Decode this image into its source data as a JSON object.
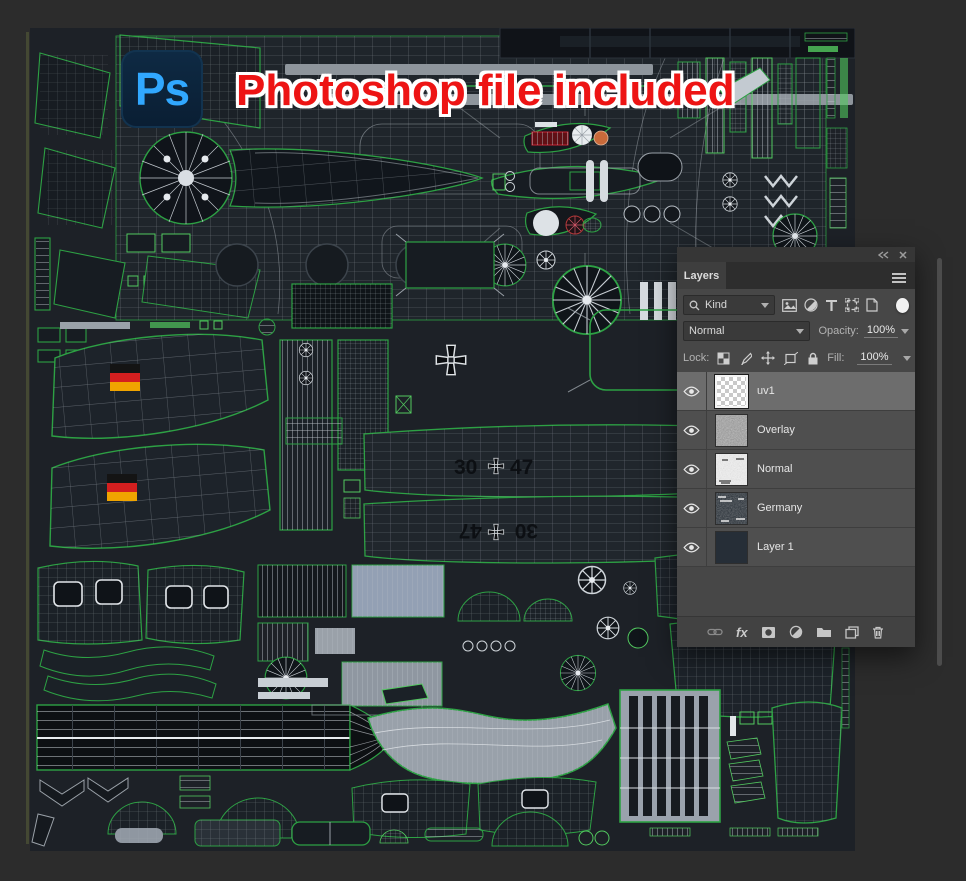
{
  "canvas": {
    "logo_text": "Ps",
    "banner_text": "Photoshop file included",
    "uv_markings": {
      "code_left": "30",
      "code_right": "47",
      "flag_black": "#141414",
      "flag_red": "#d41f1f",
      "flag_gold": "#f0a400"
    },
    "accent_green": "#2da144"
  },
  "layers_panel": {
    "title": "Layers",
    "filter": {
      "search_label": "Kind"
    },
    "blend_mode": {
      "value": "Normal"
    },
    "opacity": {
      "label": "Opacity:",
      "value": "100%"
    },
    "lock": {
      "label": "Lock:"
    },
    "fill": {
      "label": "Fill:",
      "value": "100%"
    },
    "layers": [
      {
        "name": "uv1",
        "selected": true
      },
      {
        "name": "Overlay",
        "selected": false
      },
      {
        "name": "Normal",
        "selected": false
      },
      {
        "name": "Germany",
        "selected": false
      },
      {
        "name": "Layer 1",
        "selected": false
      }
    ],
    "footer": {
      "fx_label": "fx"
    }
  }
}
